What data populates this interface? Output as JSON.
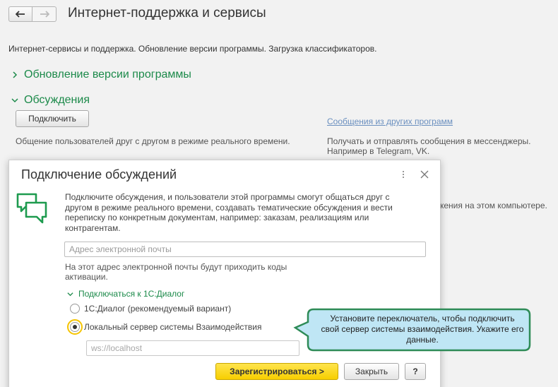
{
  "header": {
    "title": "Интернет-поддержка и сервисы"
  },
  "intro": "Интернет-сервисы и поддержка. Обновление версии программы. Загрузка классификаторов.",
  "sections": {
    "update": {
      "label": "Обновление версии программы"
    },
    "discussions": {
      "label": "Обсуждения"
    }
  },
  "background": {
    "connect_label": "Подключить",
    "desc_left": "Общение пользователей друг с другом в режиме реального времени.",
    "link_other": "Сообщения из других программ",
    "desc_right": "Получать и отправлять сообщения в мессенджеры. Например в Telegram, VK.",
    "partial_text": "кения на этом компьютере."
  },
  "dialog": {
    "title": "Подключение обсуждений",
    "description": "Подключите обсуждения, и пользователи этой программы смогут общаться друг с другом в режиме реального времени, создавать тематические обсуждения и вести переписку по конкретным документам, например: заказам, реализациям или контрагентам.",
    "email_placeholder": "Адрес электронной почты",
    "email_hint": "На этот адрес электронной почты будут приходить коды активации.",
    "subsection": "Подключаться к 1С:Диалог",
    "options": [
      {
        "label": "1С:Диалог (рекомендуемый вариант)",
        "selected": false
      },
      {
        "label": "Локальный сервер системы Взаимодействия",
        "selected": true
      }
    ],
    "server_placeholder": "ws://localhost",
    "register_label": "Зарегистрироваться >",
    "close_label": "Закрыть",
    "help_label": "?"
  },
  "callout": {
    "text": "Установите переключатель, чтобы подключить свой сервер системы взаимодействия. Укажите его данные."
  },
  "colors": {
    "accent_green": "#1c8a4a",
    "primary_button": "#f7cf00",
    "callout_fill": "#bfe6f5",
    "callout_border": "#2e8b57"
  }
}
